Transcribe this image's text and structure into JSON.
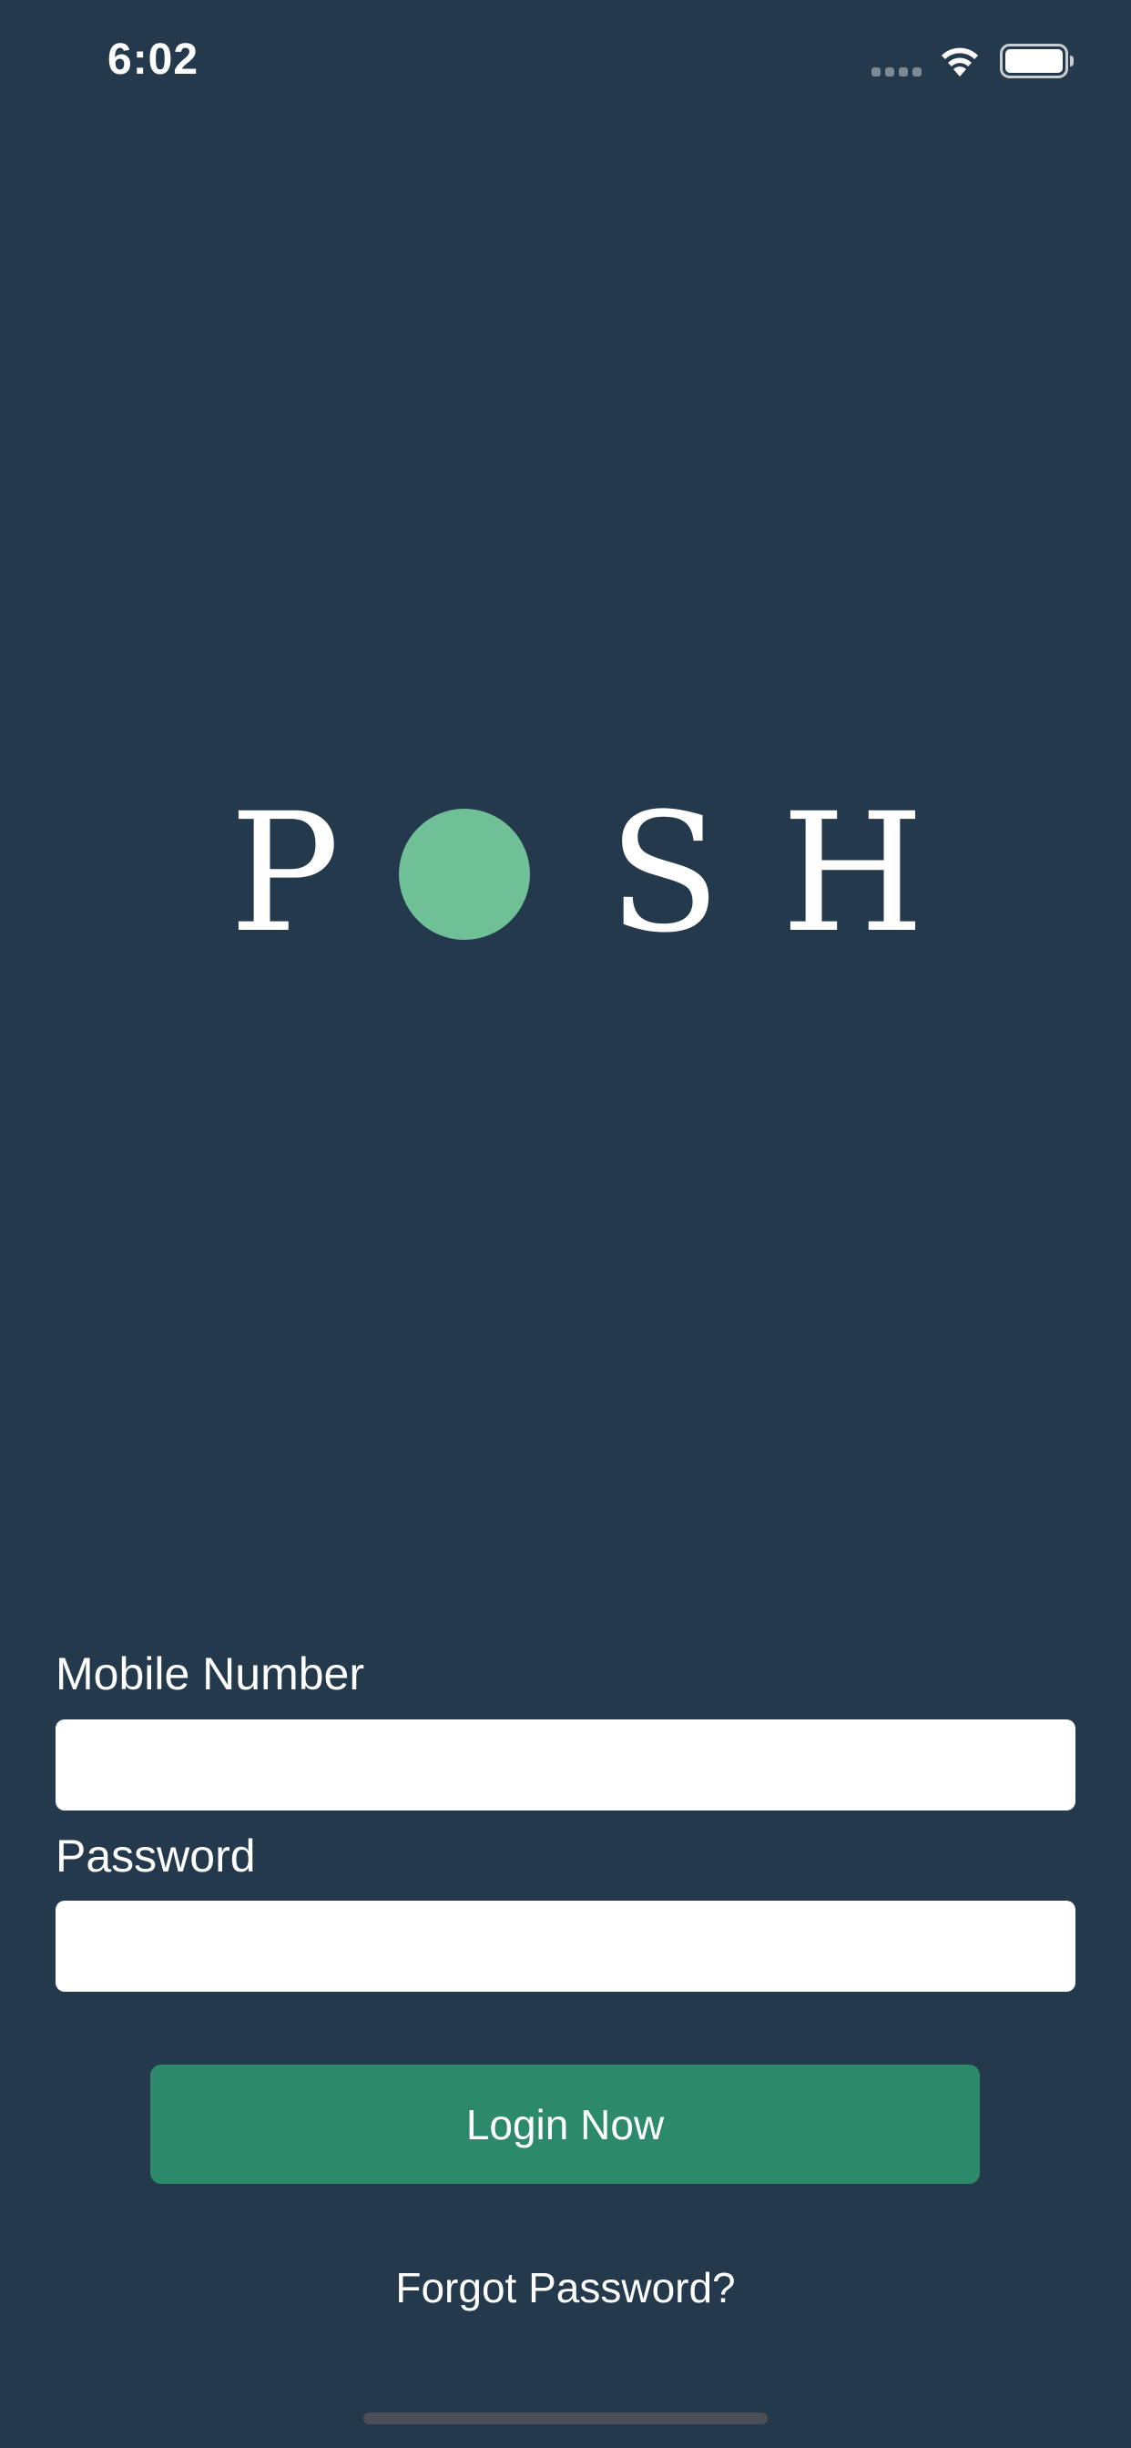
{
  "status_bar": {
    "time": "6:02",
    "signal_icon": "cellular-signal-dots",
    "wifi_icon": "wifi-icon",
    "battery_icon": "battery-full-icon"
  },
  "logo": {
    "letters": [
      "P",
      "S",
      "H"
    ],
    "dot_icon": "green-circle"
  },
  "form": {
    "mobile_label": "Mobile Number",
    "mobile_value": "",
    "mobile_placeholder": "",
    "password_label": "Password",
    "password_value": "",
    "password_placeholder": "",
    "login_label": "Login Now",
    "forgot_label": "Forgot Password?"
  },
  "colors": {
    "background": "#24394c",
    "accent": "#2c8a6a",
    "logo_dot": "#6fc097"
  }
}
